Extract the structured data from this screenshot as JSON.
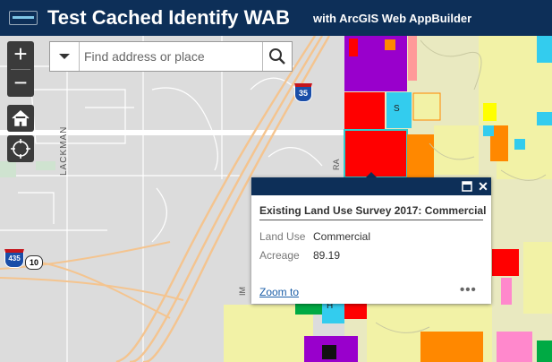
{
  "header": {
    "title": "Test Cached Identify WAB",
    "subtitle": "with ArcGIS Web AppBuilder",
    "logo_icon": "app-logo-icon"
  },
  "map_controls": {
    "zoom_in": "+",
    "zoom_out": "−",
    "home_icon": "home-icon",
    "locate_icon": "locate-crosshair-icon"
  },
  "search": {
    "placeholder": "Find address or place",
    "value": "",
    "dropdown_icon": "chevron-down-icon",
    "search_icon": "search-icon"
  },
  "map_labels": {
    "street_lackman": "LACKMAN",
    "street_ra": "RA",
    "street_im": "IM",
    "parcel_s": "S",
    "parcel_h": "H",
    "interstate_35": "35",
    "interstate_435": "435",
    "route_10": "10"
  },
  "popup": {
    "title": "Existing Land Use Survey 2017: Commercial",
    "fields": [
      {
        "label": "Land Use",
        "value": "Commercial"
      },
      {
        "label": "Acreage",
        "value": "89.19"
      }
    ],
    "zoom_link": "Zoom to",
    "more": "•••",
    "close": "✕"
  },
  "colors": {
    "header": "#0d2f58",
    "commercial": "#ff0000",
    "residential": "#f2f2a6",
    "industrial": "#9900cc",
    "public": "#33ccee",
    "highway": "#f6c79a"
  }
}
